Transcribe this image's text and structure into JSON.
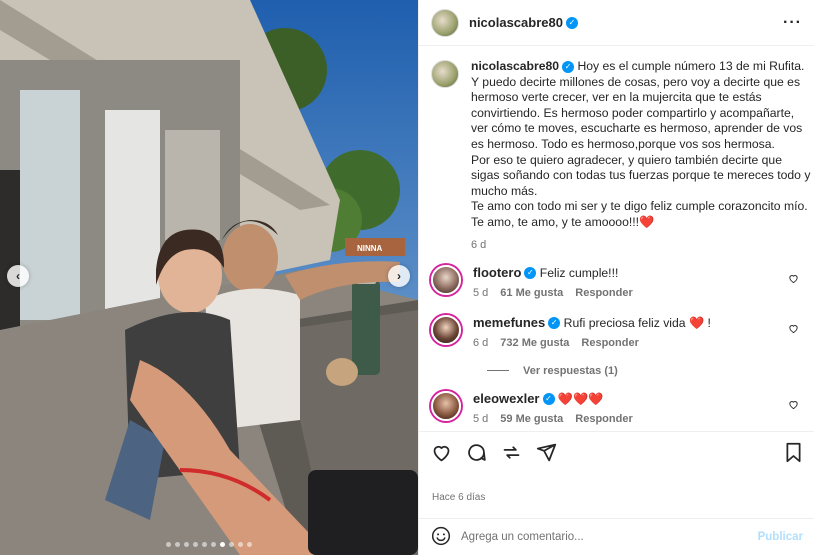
{
  "post": {
    "author": "nicolascabre80",
    "caption": "Hoy es el cumple número 13 de mi Rufita.\nY puedo decirte millones de cosas, pero voy a decirte que es hermoso verte crecer, ver en la mujercita que te estás convirtiendo. Es hermoso poder compartirlo y acompañarte, ver cómo te moves, escucharte es hermoso, aprender de vos es hermoso. Todo es hermoso,porque vos sos hermosa.\nPor eso te quiero agradecer, y quiero también decirte que sigas soñando con todas tus fuerzas porque te mereces todo y mucho más.\nTe amo con todo mi ser y te digo feliz cumple corazoncito mío.\nTe amo, te amo, y te amoooo!!!❤️",
    "caption_age": "6 d",
    "posted_ago": "Hace 6 días",
    "carousel_total": 10,
    "carousel_active_index": 6
  },
  "comments": [
    {
      "user": "flootero",
      "text": "Feliz cumple!!!",
      "age": "5 d",
      "likes": "61 Me gusta",
      "reply": "Responder"
    },
    {
      "user": "memefunes",
      "text": "Rufi preciosa feliz vida ❤️ !",
      "age": "6 d",
      "likes": "732 Me gusta",
      "reply": "Responder",
      "view_replies": "Ver respuestas (1)"
    },
    {
      "user": "eleowexler",
      "text": "❤️❤️❤️",
      "age": "5 d",
      "likes": "59 Me gusta",
      "reply": "Responder"
    }
  ],
  "comment_box": {
    "placeholder": "Agrega un comentario...",
    "publish": "Publicar"
  },
  "photo_sign": "NINNA",
  "colors": {
    "verified": "#0095f6",
    "publish_disabled": "#b2dffc",
    "story_ring": "#d6249f",
    "heart": "#ed4956"
  },
  "icons": [
    "chevron-left-icon",
    "chevron-right-icon",
    "more-icon",
    "heart-icon",
    "comment-icon",
    "share-icon",
    "send-icon",
    "save-icon",
    "emoji-icon"
  ]
}
